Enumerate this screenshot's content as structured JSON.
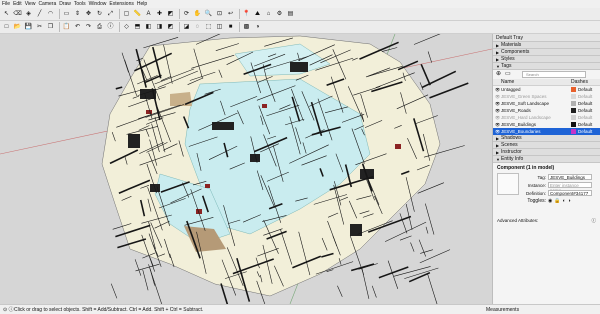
{
  "menu": [
    "File",
    "Edit",
    "View",
    "Camera",
    "Draw",
    "Tools",
    "Window",
    "Extensions",
    "Help"
  ],
  "toolbar1": [
    "select-icon",
    "eraser-icon",
    "paint-icon",
    "line-icon",
    "arc-icon",
    "rect-icon",
    "push-pull-icon",
    "move-icon",
    "rotate-icon",
    "scale-icon",
    "offset-icon",
    "tape-icon",
    "text-icon",
    "axes-icon",
    "section-icon",
    "orbit-icon",
    "pan-icon",
    "zoom-icon",
    "zoom-extents-icon",
    "previous-icon",
    "add-location-icon",
    "terrain-icon",
    "warehouse-icon",
    "extension-icon",
    "layout-icon"
  ],
  "toolbar2": [
    "new-icon",
    "open-icon",
    "save-icon",
    "cut-icon",
    "copy-icon",
    "paste-icon",
    "undo-icon",
    "redo-icon",
    "print-icon",
    "model-info-icon",
    "iso-view-icon",
    "top-view-icon",
    "front-view-icon",
    "right-view-icon",
    "back-view-icon",
    "left-view-icon",
    "xray-icon",
    "wireframe-icon",
    "hidden-line-icon",
    "shaded-icon",
    "textured-icon",
    "monochrome-icon"
  ],
  "status": {
    "message": "Click or drag to select objects. Shift = Add/Subtract. Ctrl = Add. Shift + Ctrl = Subtract.",
    "measurements_label": "Measurements"
  },
  "tray": {
    "title": "Default Tray",
    "collapsed_top": [
      "Materials",
      "Components",
      "Styles"
    ],
    "tags_title": "Tags",
    "search_placeholder": "Search",
    "col_name": "Name",
    "col_dashes": "Dashes",
    "tags": [
      {
        "name": "Untagged",
        "color": "#e8602c",
        "dashes": "Default",
        "state": "normal"
      },
      {
        "name": "JESVE_Green Spaces",
        "color": "#d9d9d9",
        "dashes": "Default",
        "state": "dim"
      },
      {
        "name": "JESVE_Soft Landscape",
        "color": "#b0b0b0",
        "dashes": "Default",
        "state": "normal"
      },
      {
        "name": "JESVE_Roads",
        "color": "#202020",
        "dashes": "Default",
        "state": "normal"
      },
      {
        "name": "JESVE_Hard Landscape",
        "color": "#d0d0d0",
        "dashes": "Default",
        "state": "dim"
      },
      {
        "name": "JESVE_Buildings",
        "color": "#111111",
        "dashes": "Default",
        "state": "normal"
      },
      {
        "name": "JESVE_Boundaries",
        "color": "#c534c8",
        "dashes": "Default",
        "state": "selected"
      }
    ],
    "collapsed_bottom": [
      "Shadows",
      "Scenes",
      "Instructor"
    ],
    "entity_info_title": "Entity Info",
    "entity": {
      "heading": "Component (1 in model)",
      "tag_label": "Tag:",
      "tag_value": "JESVE_Buildings",
      "instance_label": "Instance:",
      "instance_placeholder": "Enter instance name",
      "definition_label": "Definition:",
      "definition_value": "Component#34177",
      "toggles_label": "Toggles:",
      "advanced_label": "Advanced Attributes:"
    }
  },
  "colors": {
    "sky": "#d6d6d6",
    "map_fill": "#f2efd9",
    "water_fill": "#c9ecef",
    "road": "#161616",
    "selected_tag": "#1e63d6"
  }
}
